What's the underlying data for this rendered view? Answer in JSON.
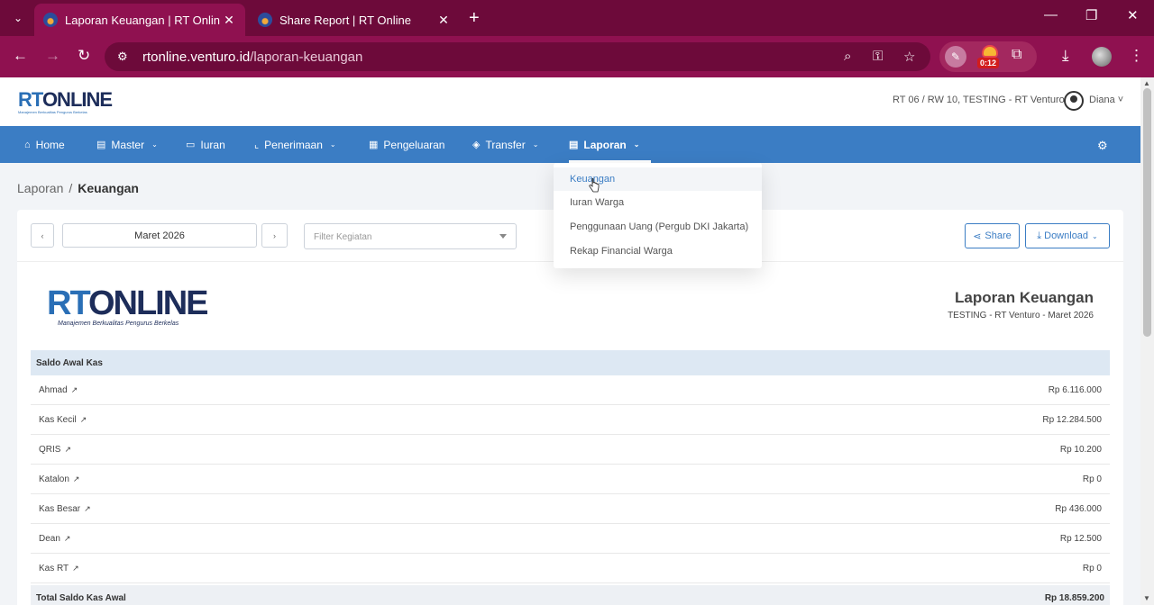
{
  "browser": {
    "tabs": [
      {
        "title": "Laporan Keuangan | RT Online",
        "active": true
      },
      {
        "title": "Share Report | RT Online",
        "active": false
      }
    ],
    "url_host": "rtonline.venturo.id",
    "url_path": "/laporan-keuangan",
    "extension_badge": "0:12"
  },
  "header": {
    "logo_text_rt": "RT",
    "logo_text_online": "ONLINE",
    "org": "RT 06 / RW 10, TESTING - RT Venturo",
    "user": "Diana"
  },
  "nav": {
    "items": [
      {
        "label": "Home",
        "icon": "home-icon",
        "has_chevron": false
      },
      {
        "label": "Master",
        "icon": "document-icon",
        "has_chevron": true
      },
      {
        "label": "Iuran",
        "icon": "card-icon",
        "has_chevron": false
      },
      {
        "label": "Penerimaan",
        "icon": "chart-icon",
        "has_chevron": true
      },
      {
        "label": "Pengeluaran",
        "icon": "receipt-icon",
        "has_chevron": false
      },
      {
        "label": "Transfer",
        "icon": "tag-icon",
        "has_chevron": true
      },
      {
        "label": "Laporan",
        "icon": "document-icon",
        "has_chevron": true,
        "active": true
      }
    ]
  },
  "laporan_menu": {
    "items": [
      "Keuangan",
      "Iuran Warga",
      "Penggunaan Uang (Pergub DKI Jakarta)",
      "Rekap Financial Warga"
    ],
    "active": "Keuangan"
  },
  "breadcrumb": {
    "parent": "Laporan",
    "sep": "/",
    "current": "Keuangan"
  },
  "filters": {
    "prev": "‹",
    "next": "›",
    "period": "Maret 2026",
    "kegiatan_placeholder": "Filter Kegiatan",
    "share_label": "Share",
    "download_label": "Download"
  },
  "report": {
    "logo_tagline": "Manajemen Berkualitas Pengurus Berkelas",
    "title": "Laporan Keuangan",
    "subtitle": "TESTING - RT Venturo - Maret 2026",
    "section_title": "Saldo Awal Kas",
    "rows": [
      {
        "name": "Ahmad",
        "value": "Rp 6.116.000"
      },
      {
        "name": "Kas Kecil",
        "value": "Rp 12.284.500"
      },
      {
        "name": "QRIS",
        "value": "Rp 10.200"
      },
      {
        "name": "Katalon",
        "value": "Rp 0"
      },
      {
        "name": "Kas Besar",
        "value": "Rp 436.000"
      },
      {
        "name": "Dean",
        "value": "Rp 12.500"
      },
      {
        "name": "Kas RT",
        "value": "Rp 0"
      }
    ],
    "total_label": "Total Saldo Kas Awal",
    "total_value": "Rp 18.859.200"
  },
  "colors": {
    "browser_frame": "#8f1150",
    "nav_blue": "#3b7dc4",
    "section_bg": "#dde8f3"
  }
}
